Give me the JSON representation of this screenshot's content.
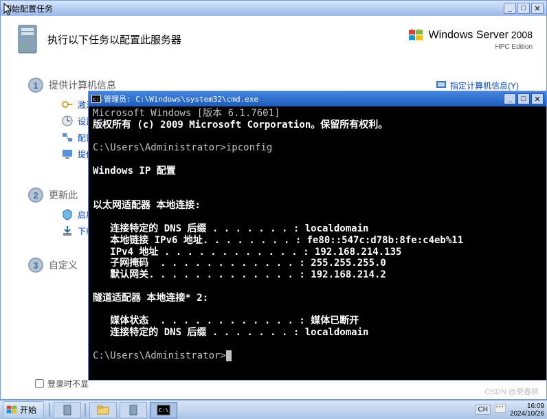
{
  "config_window": {
    "title": "切始配置任务",
    "header_text": "执行以下任务以配置此服务器",
    "server_brand": "Windows Server",
    "server_year": "2008",
    "server_edition": "HPC Edition",
    "right_link": "指定计算机信息(Y)",
    "sections": {
      "s1": {
        "num": "1",
        "title": "提供计算机信息"
      },
      "s2": {
        "num": "2",
        "title": "更新此"
      },
      "s3": {
        "num": "3",
        "title": "自定义"
      }
    },
    "links": {
      "activate": "激活",
      "set": "设置",
      "configure": "配置",
      "provide": "提供",
      "enable": "启用",
      "download": "下载"
    },
    "checkbox_label": "登录时不显"
  },
  "cmd": {
    "title": "管理员: C:\\Windows\\system32\\cmd.exe",
    "lines": {
      "l1": "Microsoft Windows [版本 6.1.7601]",
      "l2": "版权所有 (c) 2009 Microsoft Corporation。保留所有权利。",
      "l3": "",
      "l4": "C:\\Users\\Administrator>ipconfig",
      "l5": "",
      "l6": "Windows IP 配置",
      "l7": "",
      "l8": "",
      "l9": "以太网适配器 本地连接:",
      "l10": "",
      "l11": "   连接特定的 DNS 后缀 . . . . . . . : localdomain",
      "l12": "   本地链接 IPv6 地址. . . . . . . . : fe80::547c:d78b:8fe:c4eb%11",
      "l13": "   IPv4 地址 . . . . . . . . . . . . : 192.168.214.135",
      "l14": "   子网掩码  . . . . . . . . . . . . : 255.255.255.0",
      "l15": "   默认网关. . . . . . . . . . . . . : 192.168.214.2",
      "l16": "",
      "l17": "隧道适配器 本地连接* 2:",
      "l18": "",
      "l19": "   媒体状态  . . . . . . . . . . . . : 媒体已断开",
      "l20": "   连接特定的 DNS 后缀 . . . . . . . : localdomain",
      "l21": "",
      "l22_prompt": "C:\\Users\\Administrator>"
    }
  },
  "taskbar": {
    "start": "开始",
    "lang": "CH",
    "time": "16:09",
    "date": "2024/10/26"
  },
  "watermark": "CSDN @荣睿枫"
}
